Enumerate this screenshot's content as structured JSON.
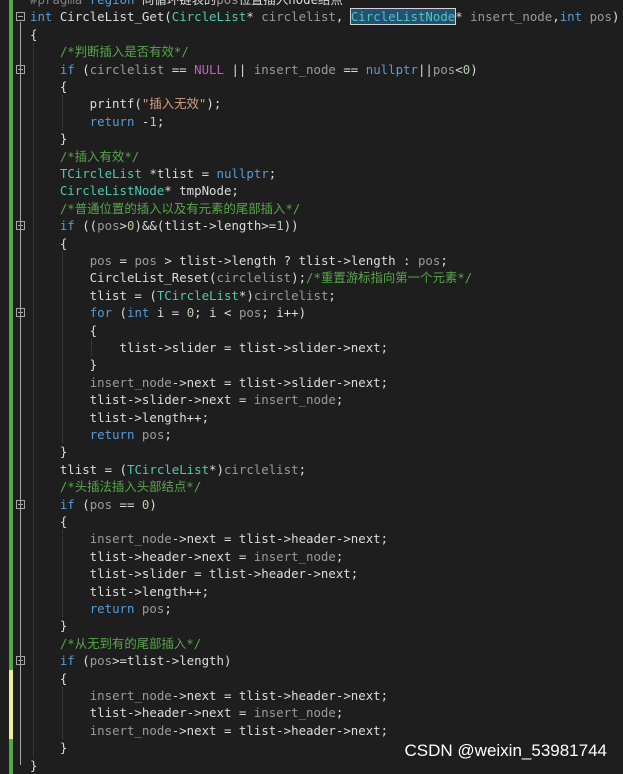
{
  "code_lines": [
    "#pragma region 向循环链表的pos位置插入node结点",
    "int CircleList_Get(CircleList* circlelist, CircleListNode* insert_node,int pos)",
    "{",
    "    /*判断插入是否有效*/",
    "    if (circlelist == NULL || insert_node == nullptr||pos<0)",
    "    {",
    "        printf(\"插入无效\");",
    "        return -1;",
    "    }",
    "    /*插入有效*/",
    "    TCircleList *tlist = nullptr;",
    "    CircleListNode* tmpNode;",
    "    /*普通位置的插入以及有元素的尾部插入*/",
    "    if ((pos>0)&&(tlist->length>=1))",
    "    {",
    "        pos = pos > tlist->length ? tlist->length : pos;",
    "        CircleList_Reset(circlelist);/*重置游标指向第一个元素*/",
    "        tlist = (TCircleList*)circlelist;",
    "        for (int i = 0; i < pos; i++)",
    "        {",
    "            tlist->slider = tlist->slider->next;",
    "        }",
    "        insert_node->next = tlist->slider->next;",
    "        tlist->slider->next = insert_node;",
    "        tlist->length++;",
    "        return pos;",
    "    }",
    "    tlist = (TCircleList*)circlelist;",
    "    /*头插法插入头部结点*/",
    "    if (pos == 0)",
    "    {",
    "        insert_node->next = tlist->header->next;",
    "        tlist->header->next = insert_node;",
    "        tlist->slider = tlist->header->next;",
    "        tlist->length++;",
    "        return pos;",
    "    }",
    "    /*从无到有的尾部插入*/",
    "    if (pos>=tlist->length)",
    "    {",
    "        insert_node->next = tlist->header->next;",
    "        tlist->header->next = insert_node;",
    "        insert_node->next = tlist->header->next;",
    "    }",
    "}"
  ],
  "highlighted_symbol": "CircleListNode",
  "watermark": "CSDN @weixin_53981744",
  "colors": {
    "background": "#1e1e1e",
    "keyword": "#569cd6",
    "type": "#4ec9b0",
    "comment": "#57a64a",
    "string": "#d69d85",
    "number": "#b5cea8",
    "macro": "#bd63c5",
    "parameter": "#9a9a9a",
    "saved_change_marker": "#57a64a",
    "unsaved_change_marker": "#efef91"
  }
}
